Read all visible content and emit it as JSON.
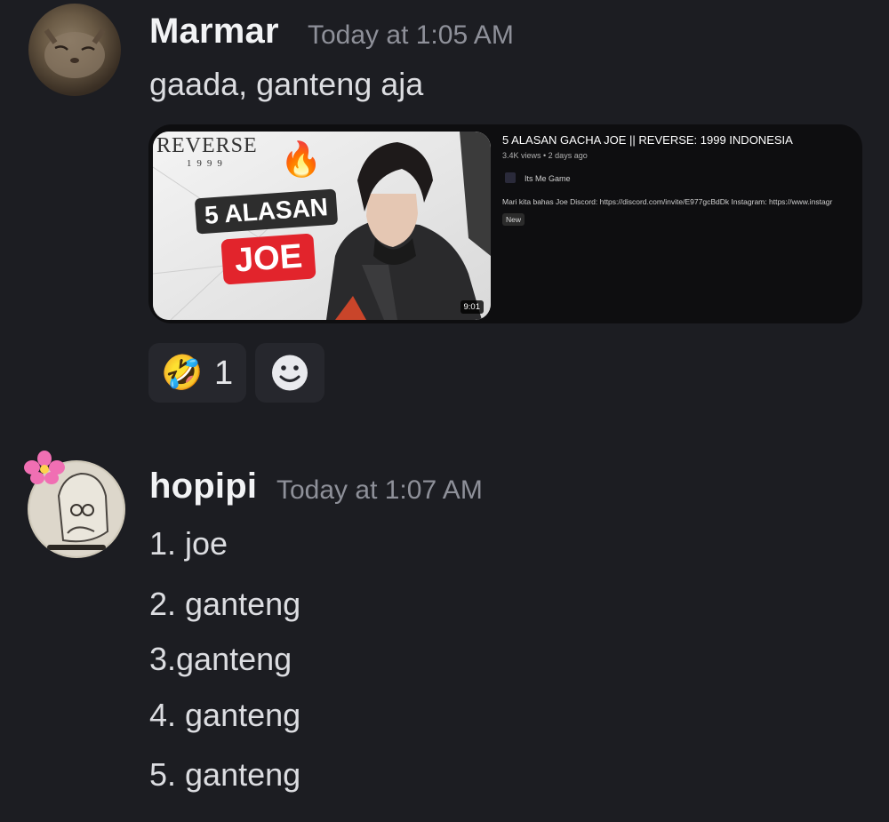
{
  "messages": [
    {
      "username": "Marmar",
      "timestamp": "Today at 1:05 AM",
      "text": "gaada, ganteng aja",
      "embed": {
        "title": "5 ALASAN GACHA JOE || REVERSE: 1999 INDONESIA",
        "meta": "3.4K views • 2 days ago",
        "channel": "Its Me Game",
        "description": "Mari kita bahas Joe Discord: https://discord.com/invite/E977gcBdDk Instagram: https://www.instagr",
        "badge": "New",
        "duration": "9:01",
        "thumbnail": {
          "logo_line1": "REVERSE",
          "logo_line2": "1999",
          "banner_line1": "5 ALASAN",
          "banner_line2": "JOE"
        }
      },
      "reactions": [
        {
          "emoji": "🤣",
          "count": "1"
        },
        {
          "emoji": "add-reaction-icon",
          "count": ""
        }
      ]
    },
    {
      "username": "hopipi",
      "timestamp": "Today at 1:07 AM",
      "lines": [
        "1.  joe",
        "2.  ganteng",
        "3.ganteng",
        "4.  ganteng",
        "5.  ganteng"
      ]
    }
  ],
  "colors": {
    "background": "#1c1d22",
    "embed_bg": "#0e0e10",
    "reaction_bg": "#26272d",
    "joe_red": "#e2242c"
  }
}
